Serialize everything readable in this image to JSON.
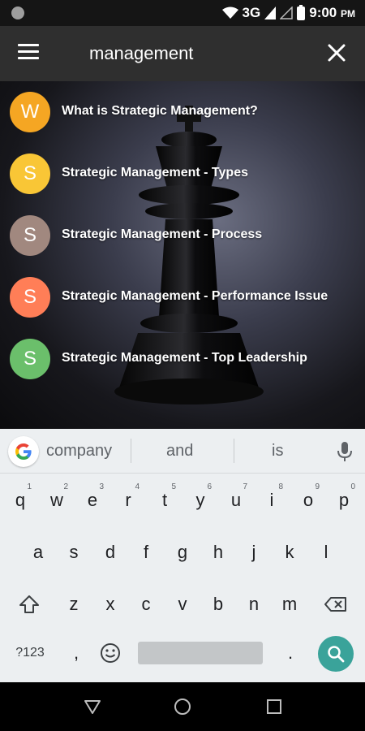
{
  "status_bar": {
    "network": "3G",
    "time": "9:00",
    "ampm": "PM"
  },
  "app_bar": {
    "search_value": "management",
    "search_placeholder": ""
  },
  "results": [
    {
      "initial": "W",
      "title": "What is Strategic Management?",
      "color": "#f5a623"
    },
    {
      "initial": "S",
      "title": "Strategic Management - Types",
      "color": "#f9c636"
    },
    {
      "initial": "S",
      "title": "Strategic Management - Process",
      "color": "#a1887f"
    },
    {
      "initial": "S",
      "title": "Strategic Management - Performance Issue",
      "color": "#ff7e57"
    },
    {
      "initial": "S",
      "title": "Strategic Management - Top Leadership",
      "color": "#6bbf6b"
    }
  ],
  "keyboard": {
    "suggestions": [
      "company",
      "and",
      "is"
    ],
    "row1": [
      {
        "k": "q",
        "h": "1"
      },
      {
        "k": "w",
        "h": "2"
      },
      {
        "k": "e",
        "h": "3"
      },
      {
        "k": "r",
        "h": "4"
      },
      {
        "k": "t",
        "h": "5"
      },
      {
        "k": "y",
        "h": "6"
      },
      {
        "k": "u",
        "h": "7"
      },
      {
        "k": "i",
        "h": "8"
      },
      {
        "k": "o",
        "h": "9"
      },
      {
        "k": "p",
        "h": "0"
      }
    ],
    "row2": [
      "a",
      "s",
      "d",
      "f",
      "g",
      "h",
      "j",
      "k",
      "l"
    ],
    "row3": [
      "z",
      "x",
      "c",
      "v",
      "b",
      "n",
      "m"
    ],
    "symbols_label": "?123",
    "comma": ",",
    "period": ".",
    "accent_color": "#3aa39a"
  },
  "icons": {
    "menu": "menu-icon",
    "close": "close-icon",
    "mic": "mic-icon",
    "shift": "shift-icon",
    "backspace": "backspace-icon",
    "emoji": "emoji-icon",
    "search": "search-icon",
    "back": "back-icon",
    "home": "home-icon",
    "recents": "recents-icon"
  }
}
